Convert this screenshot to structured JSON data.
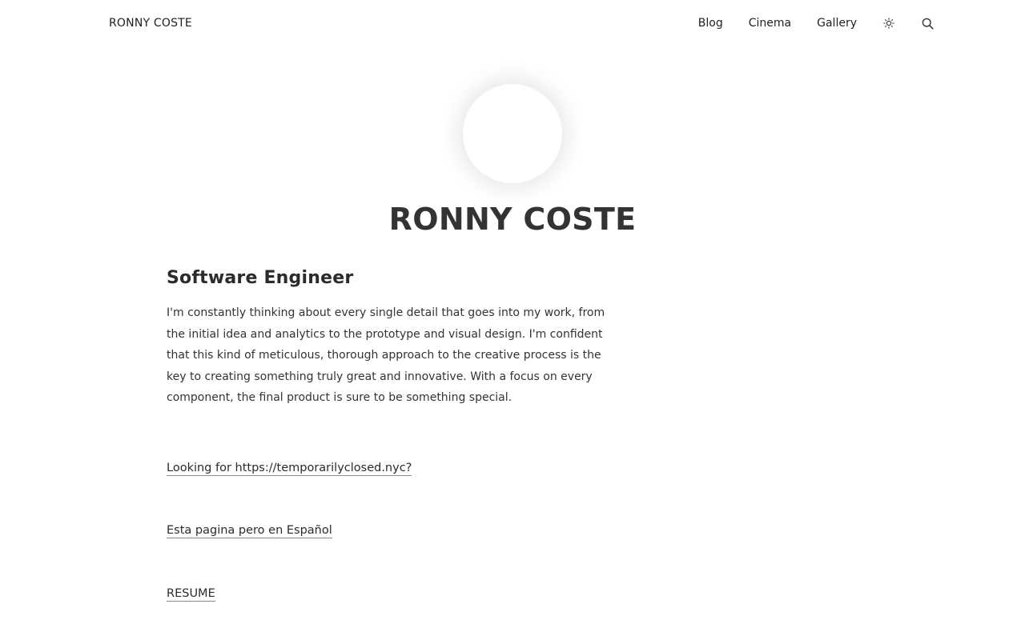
{
  "header": {
    "brand": "RONNY COSTE",
    "nav": [
      {
        "label": "Blog"
      },
      {
        "label": "Cinema"
      },
      {
        "label": "Gallery"
      }
    ],
    "theme_icon": "sun-icon",
    "search_icon": "search-icon"
  },
  "profile": {
    "name": "RONNY COSTE",
    "role": "Software Engineer",
    "bio": "I'm constantly thinking about every single detail that goes into my work, from the initial idea and analytics to the prototype and visual design. I'm confident that this kind of meticulous, thorough approach to the creative process is the key to creating something truly great and innovative. With a focus on every component, the final product is sure to be something special."
  },
  "links": {
    "temporarily_closed": "Looking for https://temporarilyclosed.nyc?",
    "spanish": "Esta pagina pero en Español",
    "resume": "RESUME"
  }
}
